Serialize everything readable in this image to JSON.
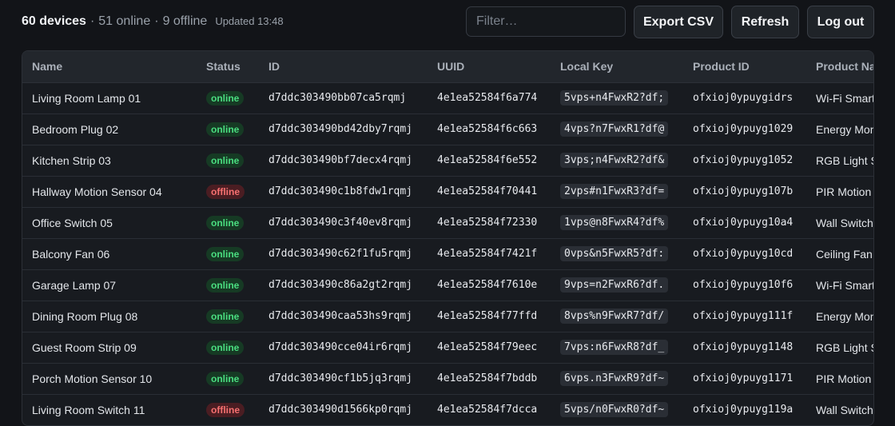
{
  "header": {
    "device_count": "60 devices",
    "online_text": "51 online",
    "offline_text": "9 offline",
    "updated": "Updated 13:48"
  },
  "filter": {
    "placeholder": "Filter…",
    "value": ""
  },
  "buttons": {
    "export": "Export CSV",
    "refresh": "Refresh",
    "logout": "Log out"
  },
  "table": {
    "columns": [
      "Name",
      "Status",
      "ID",
      "UUID",
      "Local Key",
      "Product ID",
      "Product Name"
    ],
    "rows": [
      {
        "name": "Living Room Lamp 01",
        "status": "online",
        "id": "d7ddc303490bb07ca5rqmj",
        "uuid": "4e1ea52584f6a774",
        "local_key": "5vps+n4FwxR2?df;",
        "product_id": "ofxioj0ypuygidrs",
        "product_name": "Wi-Fi Smart Bulb"
      },
      {
        "name": "Bedroom Plug 02",
        "status": "online",
        "id": "d7ddc303490bd42dby7rqmj",
        "uuid": "4e1ea52584f6c663",
        "local_key": "4vps?n7FwxR1?df@",
        "product_id": "ofxioj0ypuyg1029",
        "product_name": "Energy Monitor Plug"
      },
      {
        "name": "Kitchen Strip 03",
        "status": "online",
        "id": "d7ddc303490bf7decx4rqmj",
        "uuid": "4e1ea52584f6e552",
        "local_key": "3vps;n4FwxR2?df&",
        "product_id": "ofxioj0ypuyg1052",
        "product_name": "RGB Light Strip"
      },
      {
        "name": "Hallway Motion Sensor 04",
        "status": "offline",
        "id": "d7ddc303490c1b8fdw1rqmj",
        "uuid": "4e1ea52584f70441",
        "local_key": "2vps#n1FwxR3?df=",
        "product_id": "ofxioj0ypuyg107b",
        "product_name": "PIR Motion Sensor"
      },
      {
        "name": "Office Switch 05",
        "status": "online",
        "id": "d7ddc303490c3f40ev8rqmj",
        "uuid": "4e1ea52584f72330",
        "local_key": "1vps@n8FwxR4?df%",
        "product_id": "ofxioj0ypuyg10a4",
        "product_name": "Wall Switch"
      },
      {
        "name": "Balcony Fan 06",
        "status": "online",
        "id": "d7ddc303490c62f1fu5rqmj",
        "uuid": "4e1ea52584f7421f",
        "local_key": "0vps&n5FwxR5?df:",
        "product_id": "ofxioj0ypuyg10cd",
        "product_name": "Ceiling Fan"
      },
      {
        "name": "Garage Lamp 07",
        "status": "online",
        "id": "d7ddc303490c86a2gt2rqmj",
        "uuid": "4e1ea52584f7610e",
        "local_key": "9vps=n2FwxR6?df.",
        "product_id": "ofxioj0ypuyg10f6",
        "product_name": "Wi-Fi Smart Bulb"
      },
      {
        "name": "Dining Room Plug 08",
        "status": "online",
        "id": "d7ddc303490caa53hs9rqmj",
        "uuid": "4e1ea52584f77ffd",
        "local_key": "8vps%n9FwxR7?df/",
        "product_id": "ofxioj0ypuyg111f",
        "product_name": "Energy Monitor Plug"
      },
      {
        "name": "Guest Room Strip 09",
        "status": "online",
        "id": "d7ddc303490cce04ir6rqmj",
        "uuid": "4e1ea52584f79eec",
        "local_key": "7vps:n6FwxR8?df_",
        "product_id": "ofxioj0ypuyg1148",
        "product_name": "RGB Light Strip"
      },
      {
        "name": "Porch Motion Sensor 10",
        "status": "online",
        "id": "d7ddc303490cf1b5jq3rqmj",
        "uuid": "4e1ea52584f7bddb",
        "local_key": "6vps.n3FwxR9?df~",
        "product_id": "ofxioj0ypuyg1171",
        "product_name": "PIR Motion Sensor"
      },
      {
        "name": "Living Room Switch 11",
        "status": "offline",
        "id": "d7ddc303490d1566kp0rqmj",
        "uuid": "4e1ea52584f7dcca",
        "local_key": "5vps/n0FwxR0?df~",
        "product_id": "ofxioj0ypuyg119a",
        "product_name": "Wall Switch"
      }
    ]
  }
}
